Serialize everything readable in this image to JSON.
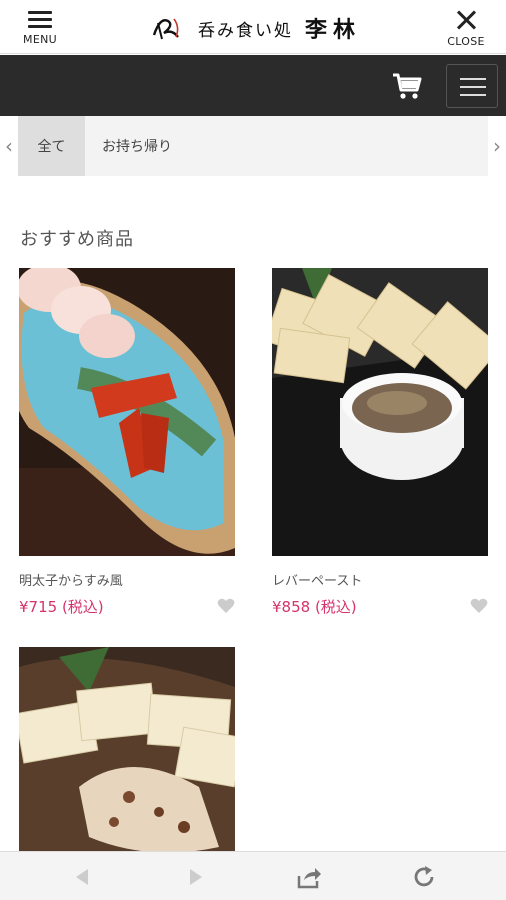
{
  "header": {
    "menu_label": "MENU",
    "close_label": "CLOSE",
    "logo_text": "呑み食い処",
    "logo_name": "李林"
  },
  "tabs": [
    {
      "label": "全て",
      "active": true
    },
    {
      "label": "お持ち帰り",
      "active": false
    }
  ],
  "section_title": "おすすめ商品",
  "products": [
    {
      "name": "明太子からすみ風",
      "price": "¥715 (税込)"
    },
    {
      "name": "レバーペースト",
      "price": "¥858 (税込)"
    },
    {
      "name": "",
      "price": ""
    }
  ],
  "colors": {
    "toolbar": "#2b2b2b",
    "price": "#d6336c"
  },
  "icons": [
    "menu-icon",
    "close-icon",
    "cart-icon",
    "hamburger-icon",
    "heart-icon",
    "back-icon",
    "forward-icon",
    "share-icon",
    "reload-icon"
  ]
}
